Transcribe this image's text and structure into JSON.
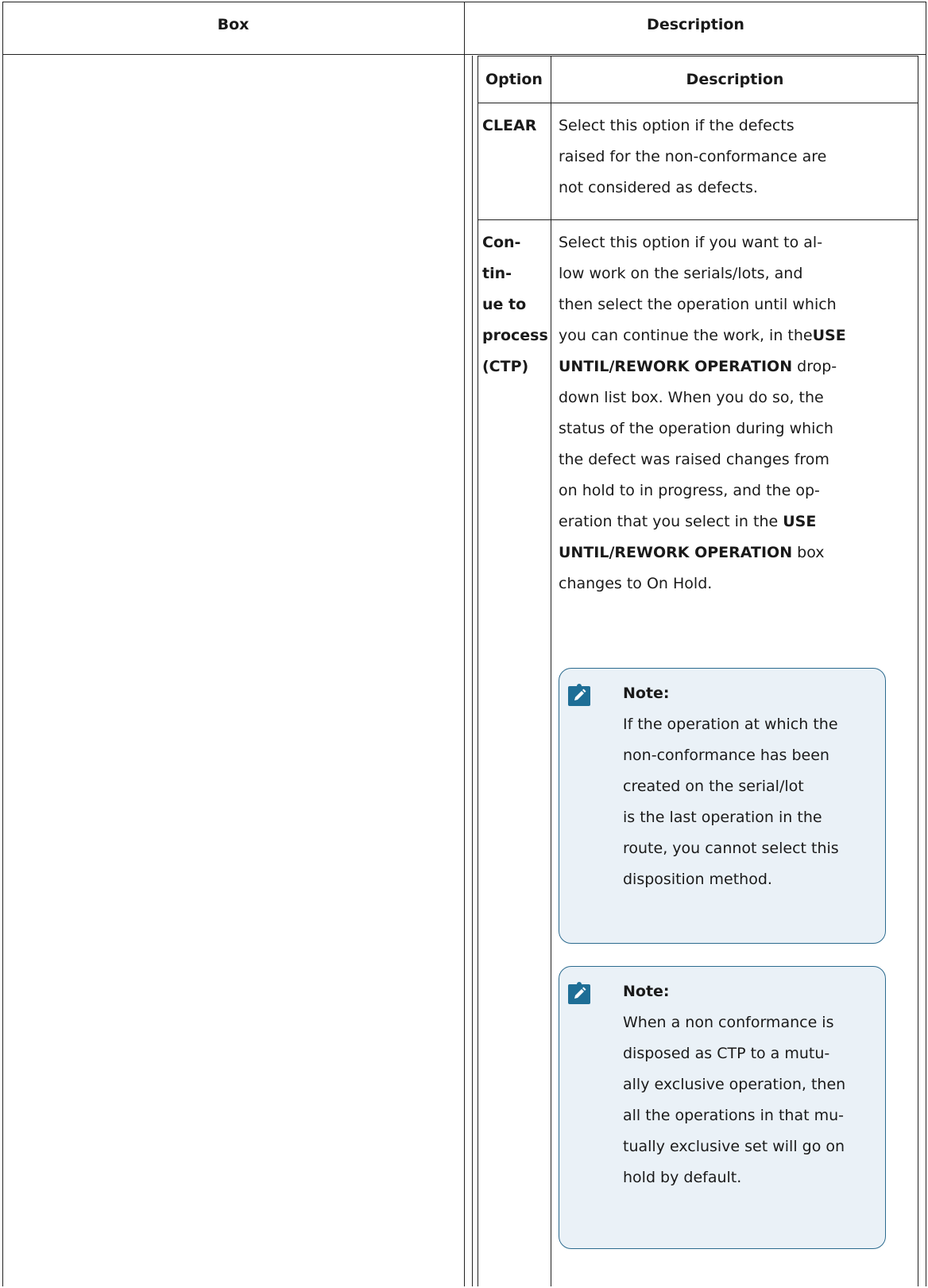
{
  "outer_header": {
    "box": "Box",
    "description": "Description"
  },
  "inner_header": {
    "option": "Option",
    "description": "Description"
  },
  "rows": [
    {
      "option_lines": [
        "CLEAR"
      ],
      "desc_lines": [
        "Select this option if the defects",
        "raised for the non-conformance are",
        "not considered as defects."
      ]
    },
    {
      "option_lines": [
        "Con-",
        "tin-",
        "ue to",
        "process",
        "(CTP)"
      ],
      "desc": {
        "l1": "Select this option if you want to al-",
        "l2": "low work on the serials/lots, and",
        "l3": "then select the operation until which",
        "l4_text": "you can continue the work, in the",
        "l4_bold": "USE",
        "l5_bold": "UNTIL/REWORK OPERATION",
        "l5_text": " drop-",
        "l6": "down list box. When you do so, the",
        "l7": "status of the operation during which",
        "l8": "the defect was raised changes from",
        "l9": "on hold to in progress, and the op-",
        "l10_text": "eration that you select in the ",
        "l10_bold": "USE",
        "l11_bold": "UNTIL/REWORK OPERATION",
        "l11_text": " box",
        "l12": "changes to On Hold."
      },
      "notes": [
        {
          "title": "Note:",
          "icon": "pencil-note-icon",
          "lines": [
            "If the operation at which the",
            "non-conformance has been",
            "created on the serial/lot",
            "is the last operation in the",
            "route, you cannot select this",
            "disposition method."
          ]
        },
        {
          "title": "Note:",
          "icon": "pencil-note-icon",
          "lines": [
            "When a non conformance is",
            "disposed as CTP to a mutu-",
            "ally exclusive operation, then",
            "all the operations in that mu-",
            "tually exclusive set will go on",
            "hold by default."
          ]
        }
      ]
    }
  ],
  "colors": {
    "note_border": "#2c6b8f",
    "note_bg": "#eaf1f7",
    "icon_fill": "#1e6e96"
  }
}
